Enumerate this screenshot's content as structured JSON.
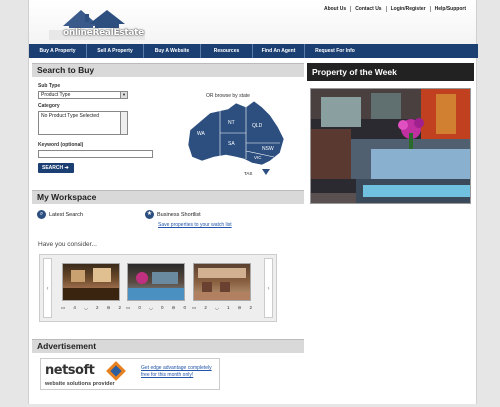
{
  "brand": {
    "logo_text": "onlineRealEstate"
  },
  "toplinks": [
    "About Us",
    "Contact Us",
    "Login/Register",
    "Help/Support"
  ],
  "nav": [
    "Buy A Property",
    "Sell A Property",
    "Buy A Website",
    "Resources",
    "Find An Agent",
    "Request For Info"
  ],
  "search": {
    "title": "Search to Buy",
    "subtype_label": "Sub Type",
    "subtype_value": "Product Type",
    "category_label": "Category",
    "category_value": "No Product Type Selected",
    "keyword_label": "Keyword (optional)",
    "keyword_value": "",
    "button": "SEARCH",
    "browse_label": "OR browse by state",
    "states": [
      "WA",
      "NT",
      "QLD",
      "SA",
      "NSW",
      "VIC",
      "TAS"
    ]
  },
  "workspace": {
    "title": "My Workspace",
    "latest": "Latest Search",
    "shortlist": "Business Shortlist",
    "save_link": "Save properties to your watch list",
    "consider": "Have you consider..."
  },
  "listings": [
    {
      "beds": "4",
      "baths": "2",
      "cars": "2"
    },
    {
      "beds": "0",
      "baths": "0",
      "cars": "0"
    },
    {
      "beds": "2",
      "baths": "1",
      "cars": "2"
    }
  ],
  "advertisement": {
    "title": "Advertisement",
    "brand": "netsoft",
    "tagline": "website solutions provider",
    "link": "Get edge advantage completely free for this month only!"
  },
  "featured": {
    "title": "Property of the Week"
  },
  "colors": {
    "nav": "#1b3f73",
    "map": "#2d4f80",
    "accent": "#e8801f"
  }
}
